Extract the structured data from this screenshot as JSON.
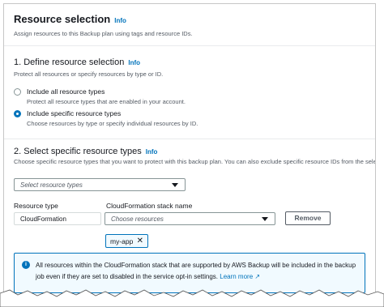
{
  "header": {
    "title": "Resource selection",
    "info": "Info",
    "description": "Assign resources to this Backup plan using tags and resource IDs."
  },
  "section1": {
    "title": "1. Define resource selection",
    "info": "Info",
    "description": "Protect all resources or specify resources by type or ID.",
    "options": [
      {
        "label": "Include all resource types",
        "description": "Protect all resource types that are enabled in your account.",
        "selected": false
      },
      {
        "label": "Include specific resource types",
        "description": "Choose resources by type or specify individual resources by ID.",
        "selected": true
      }
    ]
  },
  "section2": {
    "title": "2. Select specific resource types",
    "info": "Info",
    "description": "Choose specific resource types that you want to protect with this backup plan. You can also exclude specific resource IDs from the selection.",
    "select_placeholder": "Select resource types",
    "resource_type_label": "Resource type",
    "resource_type_value": "CloudFormation",
    "stack_label": "CloudFormation stack name",
    "stack_placeholder": "Choose resources",
    "remove_label": "Remove",
    "token": "my-app"
  },
  "alert": {
    "text": "All resources within the CloudFormation stack that are supported by AWS Backup will be included in the backup job even if they are set to disabled in the service opt-in settings.",
    "link": "Learn more",
    "color": "#0073bb"
  }
}
